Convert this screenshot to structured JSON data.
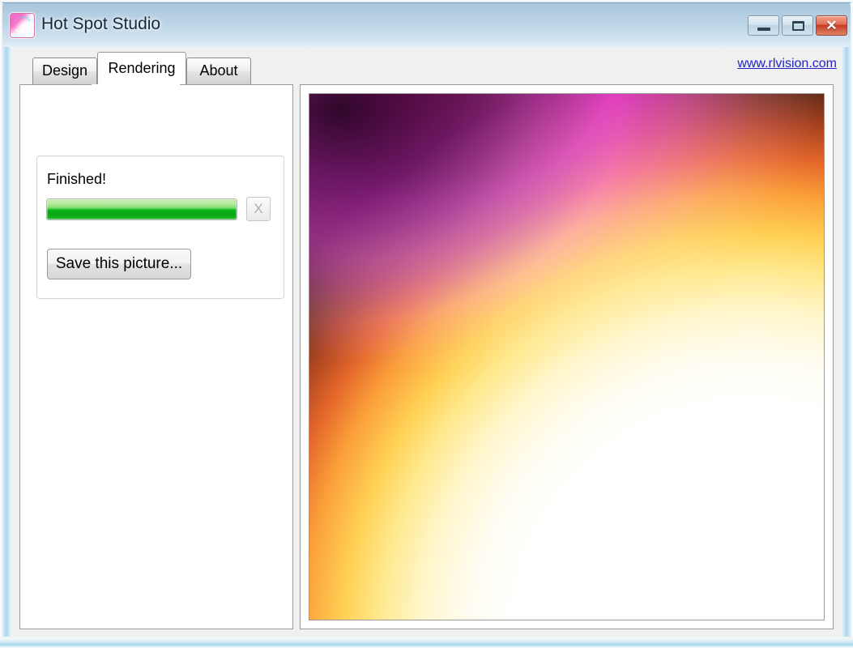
{
  "window": {
    "title": "Hot Spot Studio",
    "icon": "app-icon",
    "controls": {
      "minimize_label": "",
      "maximize_label": "",
      "close_label": "✕"
    }
  },
  "header": {
    "link_text": "www.rlvision.com"
  },
  "tabs": [
    {
      "label": "Design",
      "active": false
    },
    {
      "label": "Rendering",
      "active": true
    },
    {
      "label": "About",
      "active": false
    }
  ],
  "rendering_tab": {
    "status_label": "Finished!",
    "progress": {
      "percent": 100,
      "fill_color": "#0cb41a"
    },
    "cancel_button": {
      "label": "X",
      "enabled": false
    },
    "save_button": {
      "label": "Save this picture..."
    }
  },
  "preview": {
    "description": "rendered-hot-spot-gradient",
    "colors": {
      "hotspot_center": "#ffffff",
      "glow_yellow": "#ffe98f",
      "glow_orange": "#fba03a",
      "glow_dark": "#1c0d06",
      "lobe_magenta": "#ff1ddc"
    }
  },
  "theme": {
    "title_bar_top": "#9dbdd6",
    "title_bar_bottom": "#e9f2f8",
    "client_background": "#f0f0f0",
    "link_color": "#2323c8",
    "close_button_color": "#c73c22"
  }
}
